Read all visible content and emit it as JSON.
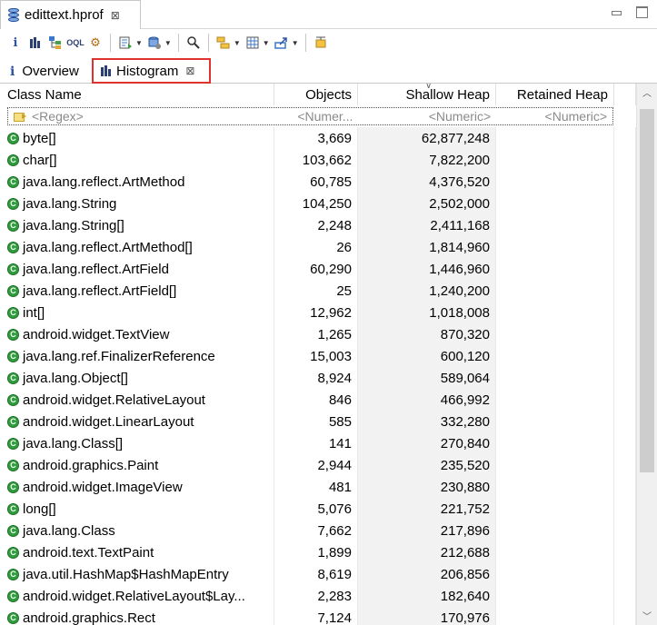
{
  "editor_tab": {
    "title": "edittext.hprof",
    "close_glyph": "⊠"
  },
  "toolbar": {
    "icons": [
      "info-icon",
      "histogram-icon",
      "dominator-tree-icon",
      "oql-icon",
      "heap-dump-overview-icon",
      "run-report-icon",
      "query-browser-icon",
      "find-object-icon",
      "group-by-icon",
      "calculate-retained-size-icon",
      "export-icon",
      "pin-icon"
    ]
  },
  "view_tabs": {
    "overview": "Overview",
    "histogram": "Histogram",
    "close_glyph": "⊠"
  },
  "table": {
    "columns": {
      "class_name": "Class Name",
      "objects": "Objects",
      "shallow_heap": "Shallow Heap",
      "retained_heap": "Retained Heap"
    },
    "filter": {
      "class_name": "<Regex>",
      "objects": "<Numer...",
      "shallow_heap": "<Numeric>",
      "retained_heap": "<Numeric>"
    },
    "rows": [
      {
        "name": "byte[]",
        "objects": "3,669",
        "shallow": "62,877,248",
        "retained": ""
      },
      {
        "name": "char[]",
        "objects": "103,662",
        "shallow": "7,822,200",
        "retained": ""
      },
      {
        "name": "java.lang.reflect.ArtMethod",
        "objects": "60,785",
        "shallow": "4,376,520",
        "retained": ""
      },
      {
        "name": "java.lang.String",
        "objects": "104,250",
        "shallow": "2,502,000",
        "retained": ""
      },
      {
        "name": "java.lang.String[]",
        "objects": "2,248",
        "shallow": "2,411,168",
        "retained": ""
      },
      {
        "name": "java.lang.reflect.ArtMethod[]",
        "objects": "26",
        "shallow": "1,814,960",
        "retained": ""
      },
      {
        "name": "java.lang.reflect.ArtField",
        "objects": "60,290",
        "shallow": "1,446,960",
        "retained": ""
      },
      {
        "name": "java.lang.reflect.ArtField[]",
        "objects": "25",
        "shallow": "1,240,200",
        "retained": ""
      },
      {
        "name": "int[]",
        "objects": "12,962",
        "shallow": "1,018,008",
        "retained": ""
      },
      {
        "name": "android.widget.TextView",
        "objects": "1,265",
        "shallow": "870,320",
        "retained": ""
      },
      {
        "name": "java.lang.ref.FinalizerReference",
        "objects": "15,003",
        "shallow": "600,120",
        "retained": ""
      },
      {
        "name": "java.lang.Object[]",
        "objects": "8,924",
        "shallow": "589,064",
        "retained": ""
      },
      {
        "name": "android.widget.RelativeLayout",
        "objects": "846",
        "shallow": "466,992",
        "retained": ""
      },
      {
        "name": "android.widget.LinearLayout",
        "objects": "585",
        "shallow": "332,280",
        "retained": ""
      },
      {
        "name": "java.lang.Class[]",
        "objects": "141",
        "shallow": "270,840",
        "retained": ""
      },
      {
        "name": "android.graphics.Paint",
        "objects": "2,944",
        "shallow": "235,520",
        "retained": ""
      },
      {
        "name": "android.widget.ImageView",
        "objects": "481",
        "shallow": "230,880",
        "retained": ""
      },
      {
        "name": "long[]",
        "objects": "5,076",
        "shallow": "221,752",
        "retained": ""
      },
      {
        "name": "java.lang.Class",
        "objects": "7,662",
        "shallow": "217,896",
        "retained": ""
      },
      {
        "name": "android.text.TextPaint",
        "objects": "1,899",
        "shallow": "212,688",
        "retained": ""
      },
      {
        "name": "java.util.HashMap$HashMapEntry",
        "objects": "8,619",
        "shallow": "206,856",
        "retained": ""
      },
      {
        "name": "android.widget.RelativeLayout$Lay...",
        "objects": "2,283",
        "shallow": "182,640",
        "retained": ""
      },
      {
        "name": "android.graphics.Rect",
        "objects": "7,124",
        "shallow": "170,976",
        "retained": ""
      }
    ]
  },
  "colors": {
    "class_icon": "#2e9e3c",
    "highlight_border": "#e0322d"
  }
}
